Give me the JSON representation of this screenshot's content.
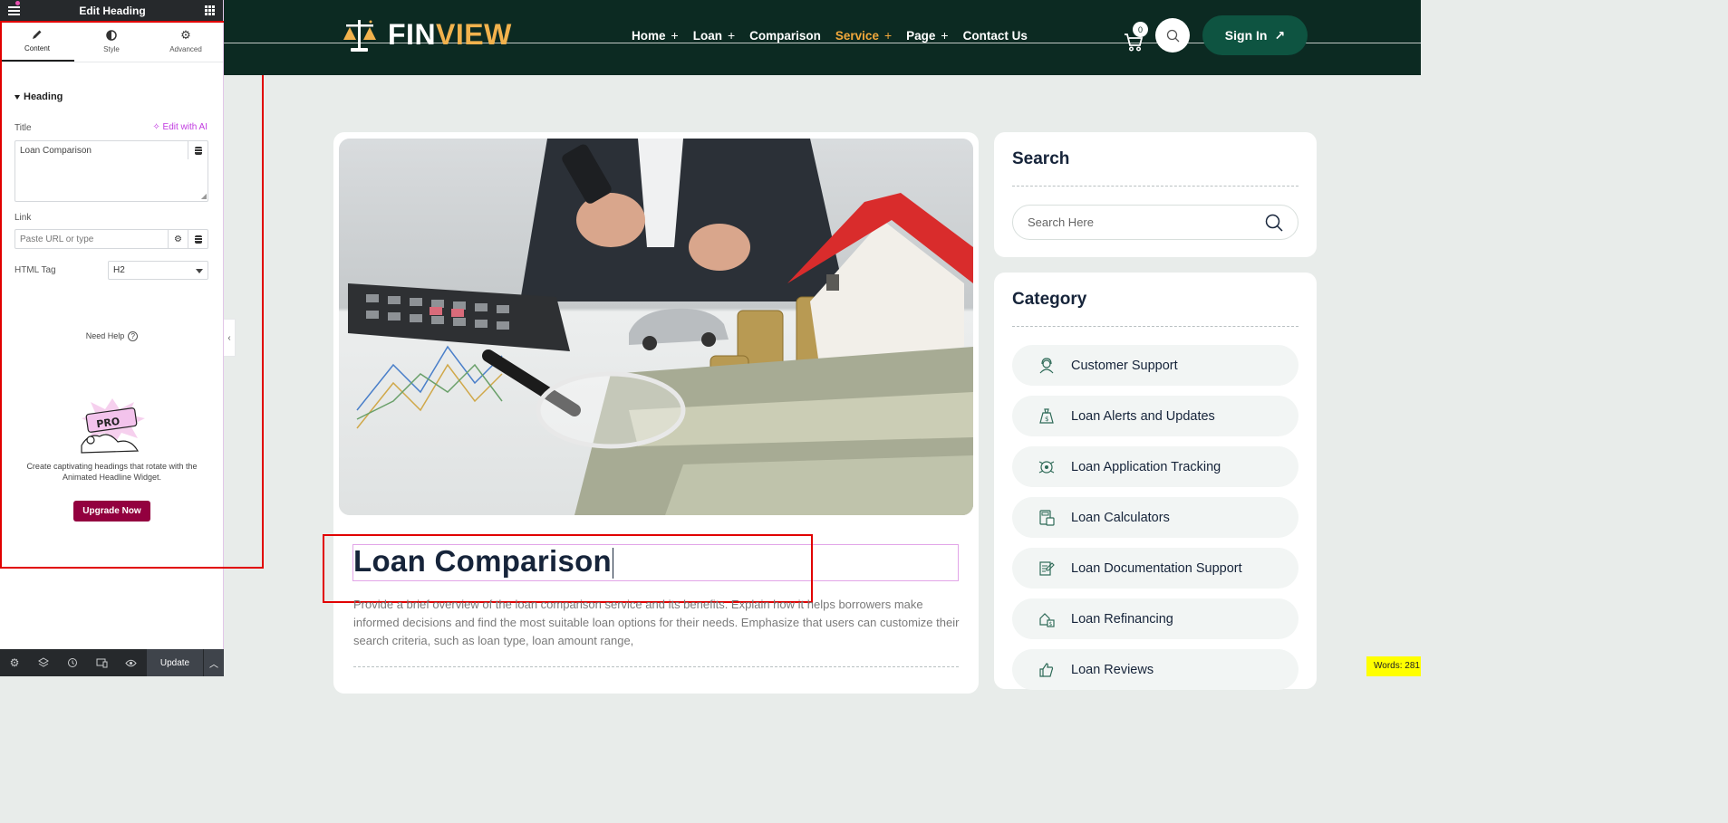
{
  "panel": {
    "title": "Edit Heading",
    "tabs": [
      {
        "label": "Content",
        "icon": "pencil-icon"
      },
      {
        "label": "Style",
        "icon": "half-circle-icon"
      },
      {
        "label": "Advanced",
        "icon": "gear-icon"
      }
    ],
    "section_title": "Heading",
    "title_label": "Title",
    "edit_ai_label": "Edit with AI",
    "title_value": "Loan Comparison",
    "link_label": "Link",
    "link_placeholder": "Paste URL or type",
    "html_tag_label": "HTML Tag",
    "html_tag_value": "H2",
    "need_help": "Need Help",
    "promo_badge": "PRO",
    "promo_text": "Create captivating headings that rotate with the Animated Headline Widget.",
    "upgrade_label": "Upgrade Now",
    "footer_update": "Update"
  },
  "site": {
    "logo_part1": "FIN",
    "logo_part2": "VIEW",
    "nav": [
      {
        "label": "Home",
        "has_plus": true
      },
      {
        "label": "Loan",
        "has_plus": true
      },
      {
        "label": "Comparison",
        "has_plus": false
      },
      {
        "label": "Service",
        "has_plus": true,
        "active": true
      },
      {
        "label": "Page",
        "has_plus": true
      },
      {
        "label": "Contact Us",
        "has_plus": false
      }
    ],
    "cart_count": "0",
    "signin_label": "Sign In"
  },
  "article": {
    "heading": "Loan Comparison",
    "paragraph": "Provide a brief overview of the loan comparison service and its benefits. Explain how it helps borrowers make informed decisions and find the most suitable loan options for their needs. Emphasize that users can customize their search criteria, such as loan type, loan amount range,"
  },
  "sidebar": {
    "search_title": "Search",
    "search_placeholder": "Search Here",
    "category_title": "Category",
    "categories": [
      "Customer Support",
      "Loan Alerts and Updates",
      "Loan Application Tracking",
      "Loan Calculators",
      "Loan Documentation Support",
      "Loan Refinancing",
      "Loan Reviews"
    ]
  },
  "word_count": "Words: 281",
  "colors": {
    "header_bg": "#0c2a22",
    "accent_gold": "#f2b24d",
    "signin_green": "#0e5441",
    "upgrade_maroon": "#93003f",
    "ai_purple": "#c13be0"
  }
}
